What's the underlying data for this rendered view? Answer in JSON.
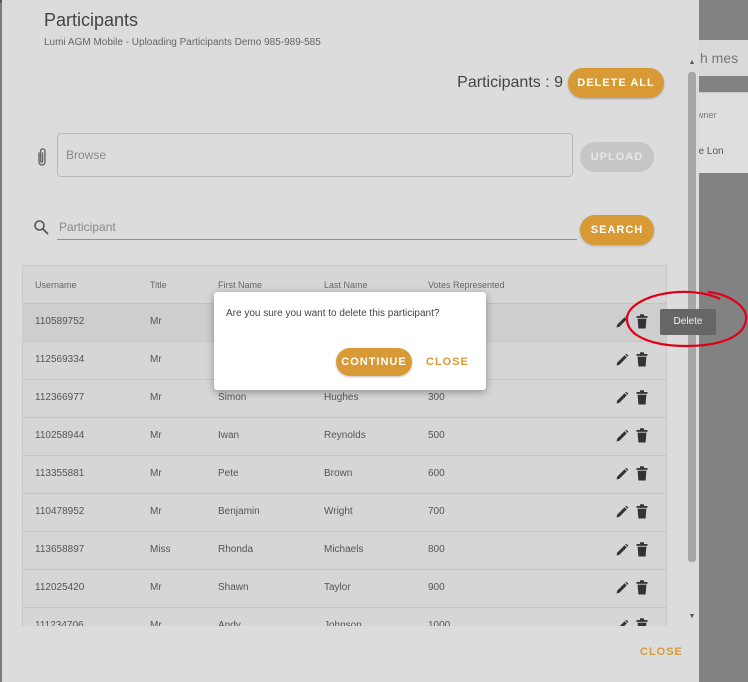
{
  "background": {
    "search_fragment": "h mes",
    "owner_header": "Owner",
    "owner_cell": "eve Lon"
  },
  "header": {
    "title": "Participants",
    "subtitle": "Lumi AGM Mobile - Uploading Participants Demo 985-989-585",
    "count_label": "Participants : 9",
    "delete_all_label": "DELETE ALL"
  },
  "upload": {
    "browse_label": "Browse",
    "upload_label": "UPLOAD"
  },
  "search": {
    "placeholder": "Participant",
    "search_label": "SEARCH"
  },
  "table": {
    "columns": [
      "Username",
      "Title",
      "First Name",
      "Last Name",
      "Votes Represented"
    ],
    "rows": [
      [
        "110589752",
        "Mr",
        "",
        "",
        ""
      ],
      [
        "112569334",
        "Mr",
        "",
        "",
        ""
      ],
      [
        "112366977",
        "Mr",
        "Simon",
        "Hughes",
        "300"
      ],
      [
        "110258944",
        "Mr",
        "Iwan",
        "Reynolds",
        "500"
      ],
      [
        "113355881",
        "Mr",
        "Pete",
        "Brown",
        "600"
      ],
      [
        "110478952",
        "Mr",
        "Benjamin",
        "Wright",
        "700"
      ],
      [
        "113658897",
        "Miss",
        "Rhonda",
        "Michaels",
        "800"
      ],
      [
        "112025420",
        "Mr",
        "Shawn",
        "Taylor",
        "900"
      ],
      [
        "111234706",
        "Mr",
        "Andy",
        "Johnson",
        "1000"
      ]
    ]
  },
  "dialog": {
    "message": "Are you sure you want to delete this participant?",
    "continue_label": "CONTINUE",
    "close_label": "CLOSE"
  },
  "tooltip": {
    "label": "Delete"
  },
  "footer": {
    "close_label": "CLOSE"
  },
  "colors": {
    "accent": "#d89a34",
    "annotation": "#e0001a",
    "panel": "#dcdcdc"
  }
}
